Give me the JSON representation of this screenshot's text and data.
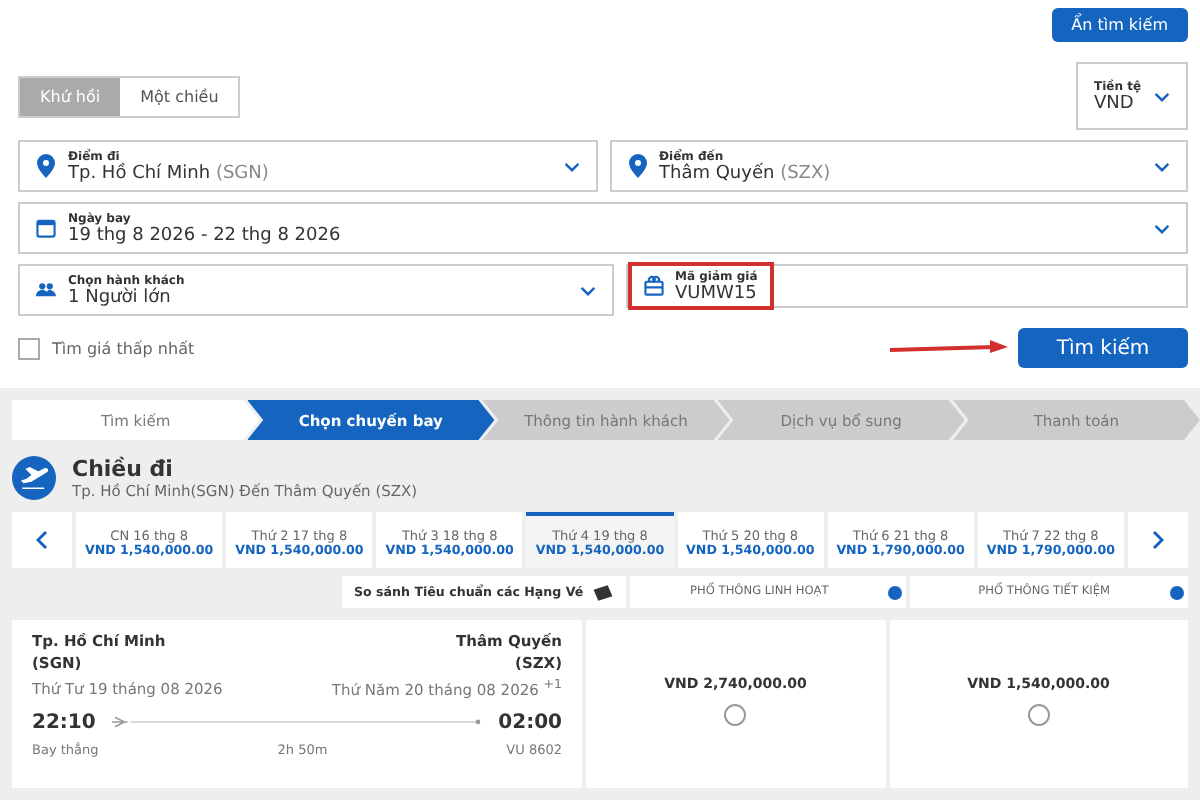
{
  "hide_search_button": "Ẩn tìm kiếm",
  "trip_types": [
    {
      "label": "Khứ hồi",
      "selected": true
    },
    {
      "label": "Một chiều",
      "selected": false
    }
  ],
  "currency": {
    "label": "Tiền tệ",
    "value": "VND"
  },
  "origin": {
    "label": "Điểm đi",
    "value": "Tp. Hồ Chí Minh",
    "code": "(SGN)"
  },
  "destination": {
    "label": "Điểm đến",
    "value": "Thâm Quyến",
    "code": "(SZX)"
  },
  "dates": {
    "label": "Ngày bay",
    "value": "19 thg 8 2026 - 22 thg 8 2026"
  },
  "passengers": {
    "label": "Chọn hành khách",
    "value": "1 Người lớn"
  },
  "promo": {
    "label": "Mã giảm giá",
    "value": "VUMW15",
    "highlighted": true
  },
  "lowest_fare": {
    "label": "Tìm giá thấp nhất",
    "checked": false
  },
  "search_button": "Tìm kiếm",
  "steps": [
    {
      "label": "Tìm kiếm",
      "selected": false
    },
    {
      "label": "Chọn chuyến bay",
      "selected": true
    },
    {
      "label": "Thông tin hành khách",
      "selected": false
    },
    {
      "label": "Dịch vụ bổ sung",
      "selected": false
    },
    {
      "label": "Thanh toán",
      "selected": false
    }
  ],
  "direction": {
    "title": "Chiều đi",
    "route": "Tp. Hồ Chí Minh(SGN) Đến Thâm Quyến (SZX)"
  },
  "date_strip": [
    {
      "day": "CN 16 thg 8",
      "price": "VND 1,540,000.00",
      "selected": false
    },
    {
      "day": "Thứ 2 17 thg 8",
      "price": "VND 1,540,000.00",
      "selected": false
    },
    {
      "day": "Thứ 3 18 thg 8",
      "price": "VND 1,540,000.00",
      "selected": false
    },
    {
      "day": "Thứ 4 19 thg 8",
      "price": "VND 1,540,000.00",
      "selected": true
    },
    {
      "day": "Thứ 5 20 thg 8",
      "price": "VND 1,540,000.00",
      "selected": false
    },
    {
      "day": "Thứ 6 21 thg 8",
      "price": "VND 1,790,000.00",
      "selected": false
    },
    {
      "day": "Thứ 7 22 thg 8",
      "price": "VND 1,790,000.00",
      "selected": false
    }
  ],
  "compare_label": "So sánh Tiêu chuẩn các Hạng Vé",
  "fare_classes": [
    "PHỔ THÔNG LINH HOẠT",
    "PHỔ THÔNG TIẾT KIỆM"
  ],
  "flight": {
    "from_city": "Tp. Hồ Chí Minh",
    "from_code": "(SGN)",
    "to_city": "Thâm Quyến",
    "to_code": "(SZX)",
    "depart_date": "Thứ Tư 19 tháng 08 2026",
    "arrive_date": "Thứ Năm 20 tháng 08 2026 $^{+1}$",
    "depart_time": "22:10",
    "arrive_time": "02:00",
    "type": "Bay thẳng",
    "duration": "2h 50m",
    "flight_no": "VU 8602",
    "fares": [
      {
        "price": "VND 2,740,000.00",
        "selected": false
      },
      {
        "price": "VND 1,540,000.00",
        "selected": false
      }
    ]
  }
}
